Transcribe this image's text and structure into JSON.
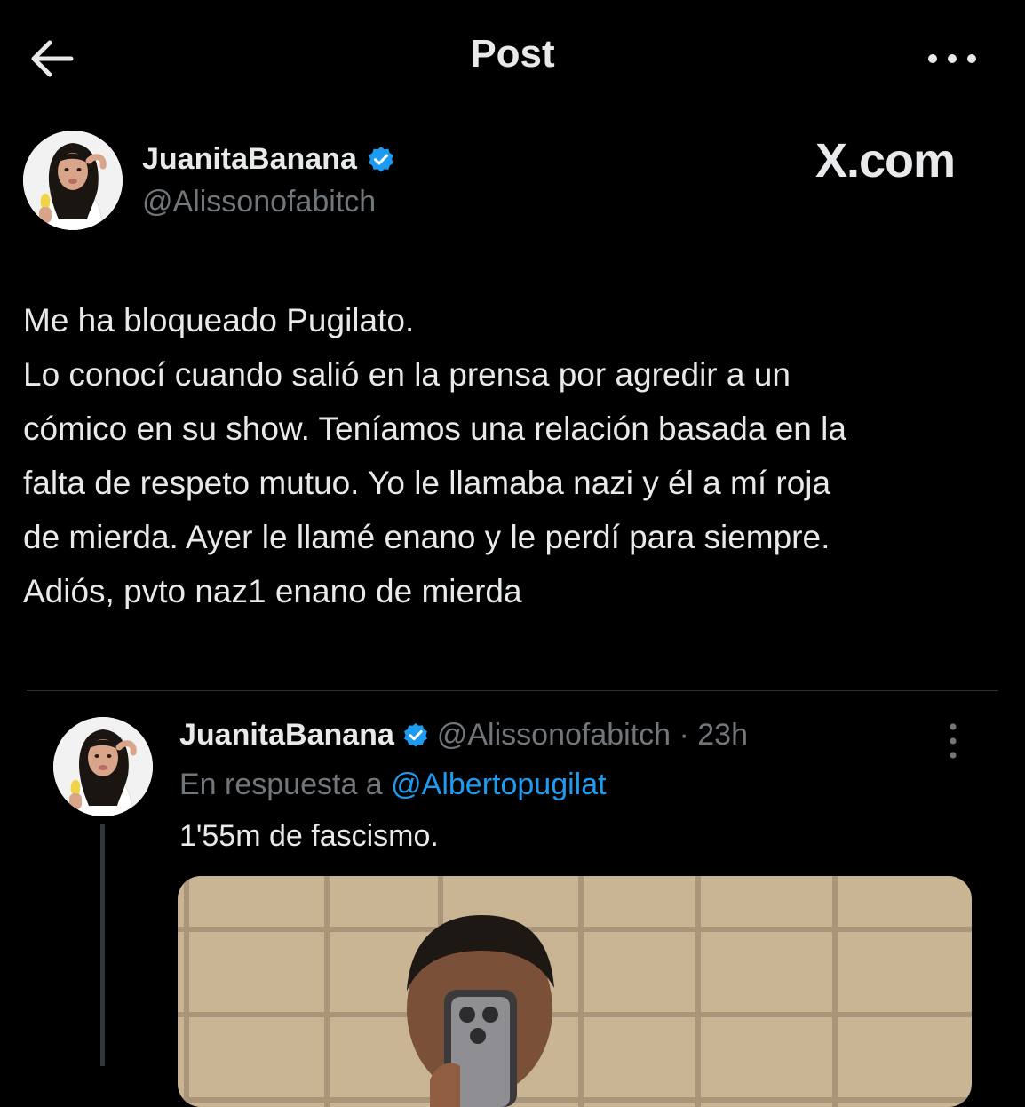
{
  "header": {
    "back_icon": "arrow-left-icon",
    "title": "Post",
    "more_icon": "more-horizontal-icon"
  },
  "author": {
    "name": "JuanitaBanana",
    "verified_icon": "verified-badge-icon",
    "handle": "@Alissonofabitch",
    "avatar_icon": "avatar-photo"
  },
  "watermark": {
    "text": "X.com"
  },
  "tweet": {
    "lines": [
      "Me ha bloqueado Pugilato.",
      "Lo conocí cuando salió en la prensa por agredir a un",
      "cómico en su show. Teníamos una relación basada en la",
      "falta de respeto mutuo. Yo le llamaba nazi y él a mí roja",
      "de mierda. Ayer le llamé enano y le perdí para siempre.",
      "Adiós, pvto naz1 enano de mierda"
    ]
  },
  "reply": {
    "name": "JuanitaBanana",
    "meta": "@Alissonofabitch · 23h",
    "reply_prefix": "En respuesta a ",
    "reply_to_handle": "@Albertopugilat",
    "text": "1'55m de fascismo.",
    "more_icon": "more-vertical-icon",
    "media_icon": "photo-selfie-mirror"
  },
  "colors": {
    "background": "#000000",
    "text_primary": "#e7e9ea",
    "text_secondary": "#71767b",
    "link": "#1d9bf0",
    "verified": "#1d9bf0",
    "divider": "#2f3336"
  }
}
